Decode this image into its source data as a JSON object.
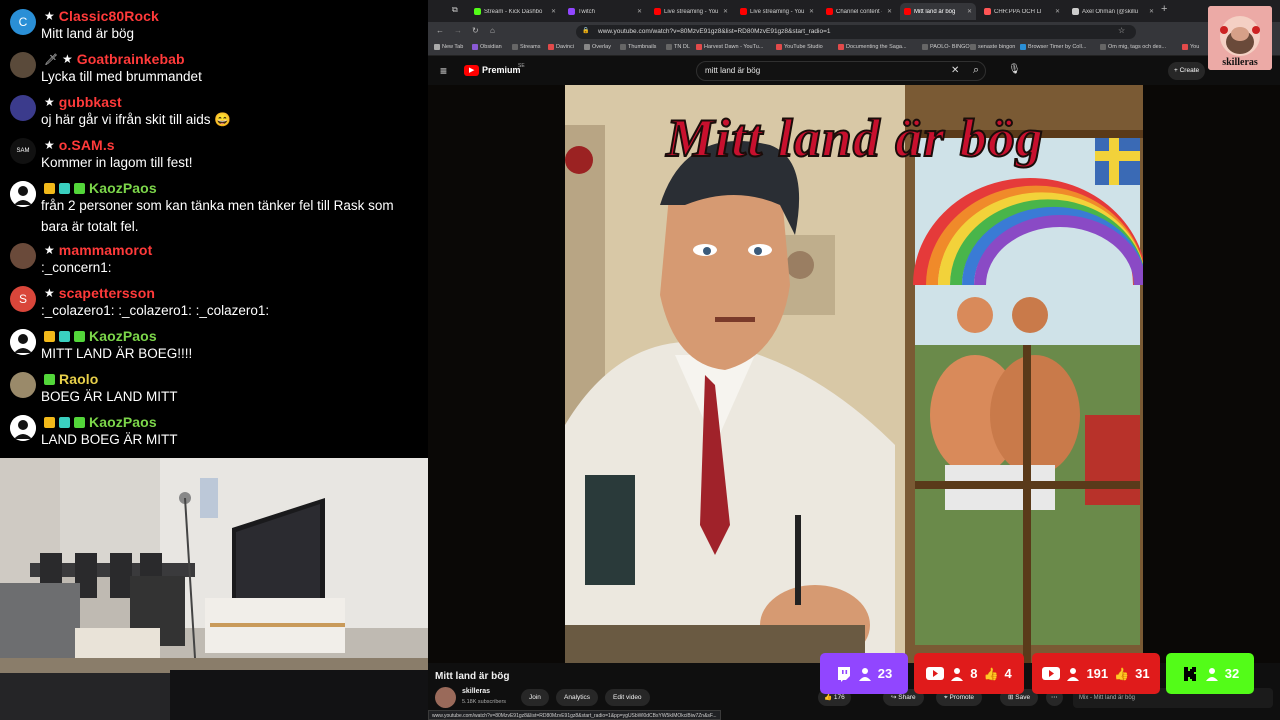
{
  "chat": {
    "messages": [
      {
        "user": "Classic80Rock",
        "user_color": "#ff3a3a",
        "text": "Mitt land är bög",
        "avatar_letter": "C",
        "avatar_color": "#2a8fd6",
        "badges": [
          "star"
        ]
      },
      {
        "user": "Goatbrainkebab",
        "user_color": "#ff3a3a",
        "text": "Lycka till med brummandet",
        "avatar_letter": "",
        "avatar_color": "#5a4a3a",
        "badges": [
          "sword",
          "star"
        ]
      },
      {
        "user": "gubbkast",
        "user_color": "#ff3a3a",
        "text": "oj här går vi ifrån skit till aids 😄",
        "avatar_letter": "",
        "avatar_color": "#3b3b8c",
        "badges": [
          "star"
        ]
      },
      {
        "user": "o.SAM.s",
        "user_color": "#ff3a3a",
        "text": "Kommer in lagom till fest!",
        "avatar_letter": "SAM",
        "avatar_color": "#111111",
        "badges": [
          "star"
        ]
      },
      {
        "user": "KaozPaos",
        "user_color": "#7cd64a",
        "text": "från 2 personer som kan tänka men tänker fel till Rask som bara är totalt fel.",
        "avatar_letter": "",
        "avatar_color": "#ffffff",
        "badges": [
          "crown",
          "grid",
          "gift"
        ]
      },
      {
        "user": "mammamorot",
        "user_color": "#ff3a3a",
        "text": ":_concern1:",
        "avatar_letter": "",
        "avatar_color": "#6a4a3a",
        "badges": [
          "star"
        ]
      },
      {
        "user": "scapettersson",
        "user_color": "#ff3a3a",
        "text": ":_colazero1: :_colazero1: :_colazero1:",
        "avatar_letter": "S",
        "avatar_color": "#d9463a",
        "badges": [
          "star"
        ]
      },
      {
        "user": "KaozPaos",
        "user_color": "#7cd64a",
        "text": "MITT LAND ÄR BOEG!!!!",
        "avatar_letter": "",
        "avatar_color": "#ffffff",
        "badges": [
          "crown",
          "grid",
          "gift"
        ]
      },
      {
        "user": "Raolo",
        "user_color": "#e8d04a",
        "text": "BOEG ÄR LAND MITT",
        "avatar_letter": "",
        "avatar_color": "#9a8a6a",
        "badges": [
          "gift"
        ]
      },
      {
        "user": "KaozPaos",
        "user_color": "#7cd64a",
        "text": "LAND BOEG ÄR MITT",
        "avatar_letter": "",
        "avatar_color": "#ffffff",
        "badges": [
          "crown",
          "grid",
          "gift"
        ]
      }
    ]
  },
  "browser": {
    "tabs": [
      {
        "label": "Stream - Kick Dashbo",
        "color": "#53fc18"
      },
      {
        "label": "Twitch",
        "color": "#9146ff"
      },
      {
        "label": "Live streaming - YouT",
        "color": "#ff0000"
      },
      {
        "label": "Live streaming - YouT",
        "color": "#ff0000"
      },
      {
        "label": "Channel content - You",
        "color": "#ff0000"
      },
      {
        "label": "Mitt land är bög",
        "color": "#ff0000"
      },
      {
        "label": "CHR:PPA OCH LI",
        "color": "#ff5555"
      },
      {
        "label": "Axel Öhman (@skillu",
        "color": "#cccccc"
      }
    ],
    "url": "www.youtube.com/watch?v=80MzvE91gz8&list=RD80MzvE91gz8&start_radio=1",
    "bookmarks": [
      "New Tab",
      "Obsidian",
      "Streams",
      "Davinci",
      "Overlay",
      "Thumbnails",
      "TN DL",
      "Harvest Dawn - YouTu...",
      "YouTube Studio",
      "Documenting the Saga...",
      "PAOLO- BINGO",
      "senaste bingon",
      "Browser Timer by Coll...",
      "Om mig, tags och des...",
      "You"
    ],
    "premium_label": "Premium",
    "premium_sup": "SE",
    "search_value": "mitt land är bög",
    "create_label": "Create",
    "status_url": "www.youtube.com/watch?v=80MzvE91gz8&list=RD80MzvE91gz8&start_radio=1&pp=ygUSbWl0dCBsYW5kIMOkciBiw7Zn&sF..."
  },
  "video": {
    "poster_title": "Mitt land är bög",
    "title": "Mitt land är bög",
    "channel": "skilleras",
    "subscribers": "5.18K subscribers",
    "join_label": "Join",
    "analytics_label": "Analytics",
    "edit_label": "Edit video",
    "likes": "176",
    "share_label": "Share",
    "promote_label": "Promote",
    "save_label": "Save",
    "sidebar_title": "Mix - Mitt land är bög"
  },
  "overlay": {
    "logo_name": "skilleras",
    "viewers": [
      {
        "platform": "twitch",
        "bg": "#9146ff",
        "viewers": "23"
      },
      {
        "platform": "youtube",
        "bg": "#e01b1b",
        "viewers": "8",
        "likes": "4"
      },
      {
        "platform": "youtube",
        "bg": "#e01b1b",
        "viewers": "191",
        "likes": "31"
      },
      {
        "platform": "kick",
        "bg": "#53fc18",
        "viewers": "32"
      }
    ]
  },
  "colors": {
    "accent_red": "#ff0000",
    "twitch": "#9146ff",
    "kick": "#53fc18"
  }
}
